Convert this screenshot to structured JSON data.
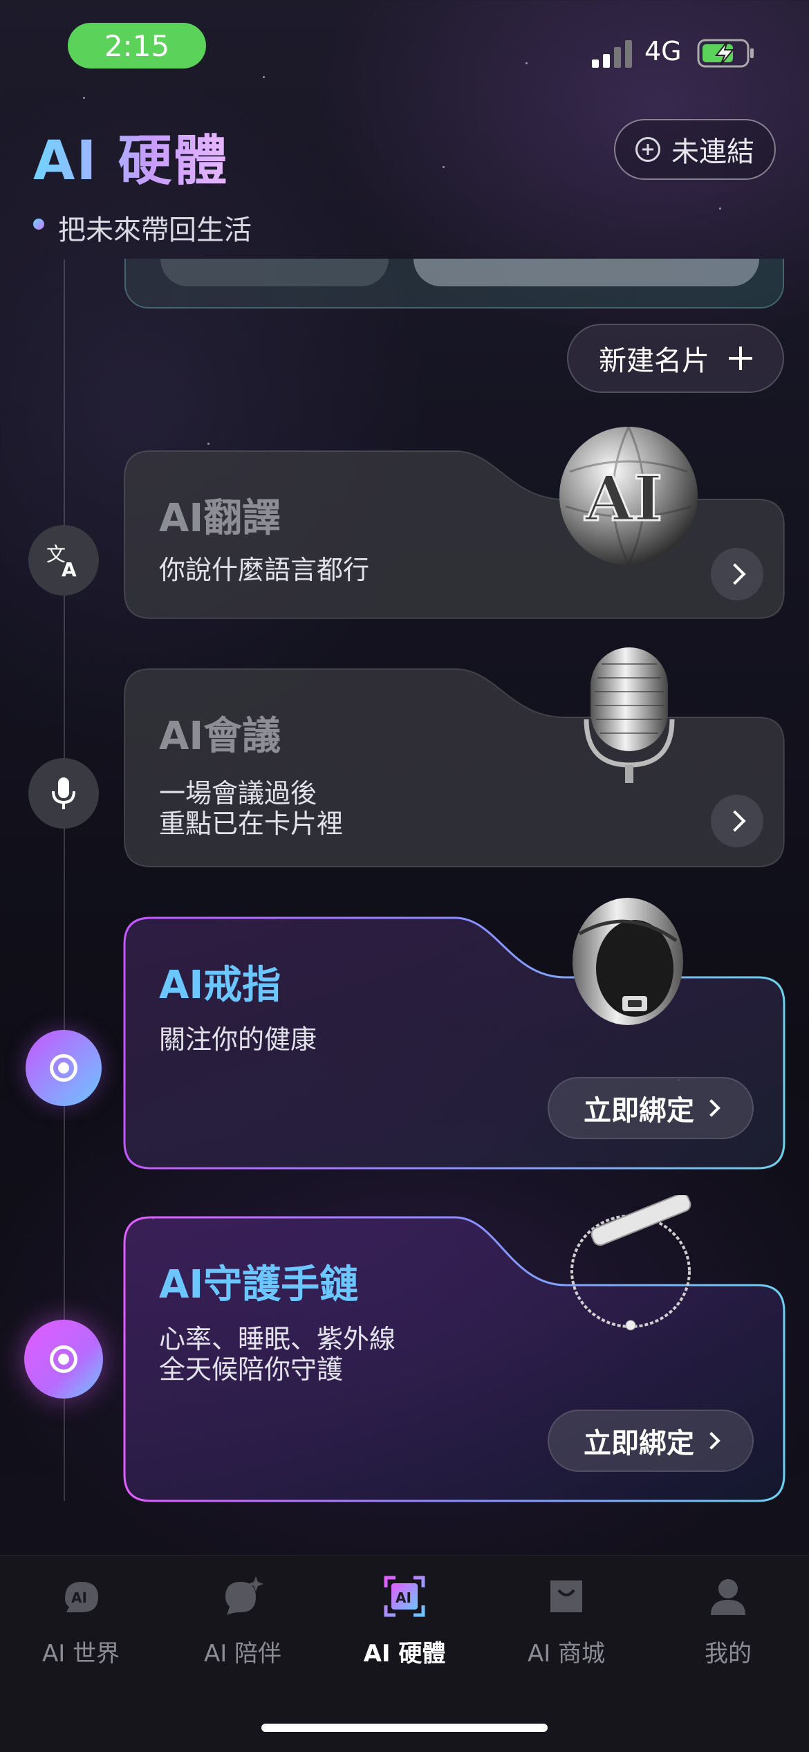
{
  "status_bar": {
    "time": "2:15",
    "network": "4G",
    "battery": "charging"
  },
  "header": {
    "title": "AI 硬體",
    "subtitle": "把未來帶回生活",
    "connect_button": "未連結"
  },
  "new_card_button": "新建名片",
  "cards": [
    {
      "title": "AI翻譯",
      "desc": [
        "你說什麼語言都行"
      ],
      "icon": "translate-icon",
      "image": "ai-globe"
    },
    {
      "title": "AI會議",
      "desc": [
        "一場會議過後",
        "重點已在卡片裡"
      ],
      "icon": "microphone-icon",
      "image": "microphone"
    },
    {
      "title": "AI戒指",
      "desc": [
        "關注你的健康"
      ],
      "button": "立即綁定",
      "icon": "radio-icon",
      "image": "smart-ring"
    },
    {
      "title": "AI守護手鏈",
      "desc": [
        "心率、睡眠、紫外線",
        "全天候陪你守護"
      ],
      "button": "立即綁定",
      "icon": "radio-icon",
      "image": "bracelet"
    }
  ],
  "bottom_nav": [
    {
      "label": "AI 世界",
      "icon": "ai-world-icon",
      "active": false
    },
    {
      "label": "AI 陪伴",
      "icon": "ai-companion-icon",
      "active": false
    },
    {
      "label": "AI 硬體",
      "icon": "ai-hardware-icon",
      "active": true
    },
    {
      "label": "AI 商城",
      "icon": "ai-shop-icon",
      "active": false
    },
    {
      "label": "我的",
      "icon": "profile-icon",
      "active": false
    }
  ],
  "colors": {
    "accent_cyan": "#6cc6ff",
    "accent_purple": "#c657ff",
    "time_pill": "#5bd25a"
  }
}
